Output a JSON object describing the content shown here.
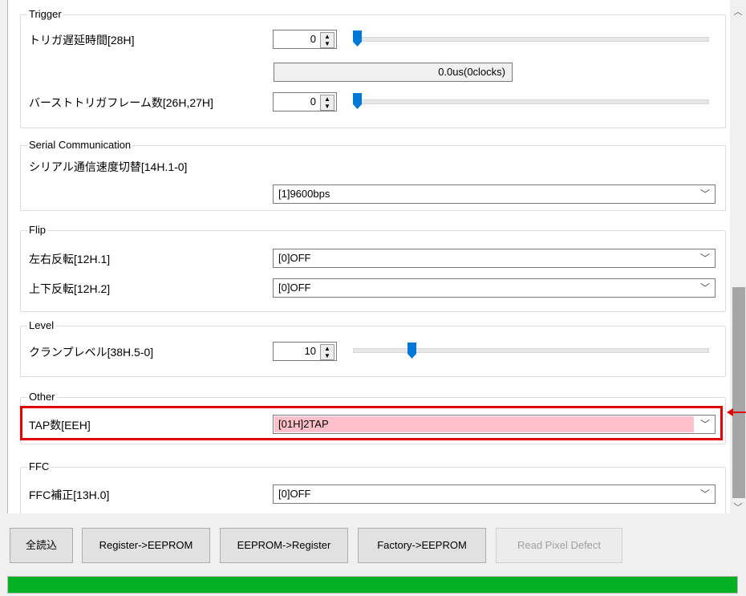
{
  "trigger": {
    "title": "Trigger",
    "delay_label": "トリガ遅延時間[28H]",
    "delay_value": "0",
    "delay_readout": "0.0us(0clocks)",
    "burst_label": "バーストトリガフレーム数[26H,27H]",
    "burst_value": "0"
  },
  "serial": {
    "title": "Serial Communication",
    "speed_label": "シリアル通信速度切替[14H.1-0]",
    "speed_value": "[1]9600bps"
  },
  "flip": {
    "title": "Flip",
    "lr_label": "左右反転[12H.1]",
    "lr_value": "[0]OFF",
    "ud_label": "上下反転[12H.2]",
    "ud_value": "[0]OFF"
  },
  "level": {
    "title": "Level",
    "clamp_label": "クランプレベル[38H.5-0]",
    "clamp_value": "10"
  },
  "other": {
    "title": "Other",
    "tap_label": "TAP数[EEH]",
    "tap_value": "[01H]2TAP"
  },
  "ffc": {
    "title": "FFC",
    "correction_label": "FFC補正[13H.0]",
    "correction_value": "[0]OFF"
  },
  "buttons": {
    "read_all": "全読込",
    "reg_to_eeprom": "Register->EEPROM",
    "eeprom_to_reg": "EEPROM->Register",
    "factory_to_eeprom": "Factory->EEPROM",
    "read_pixel_defect": "Read Pixel Defect"
  },
  "colors": {
    "highlight": "#e00000",
    "tap_field_bg": "#ffc0cb",
    "progress": "#06b025",
    "slider_thumb": "#0078d7"
  },
  "progress": {
    "fraction": 1.0
  }
}
